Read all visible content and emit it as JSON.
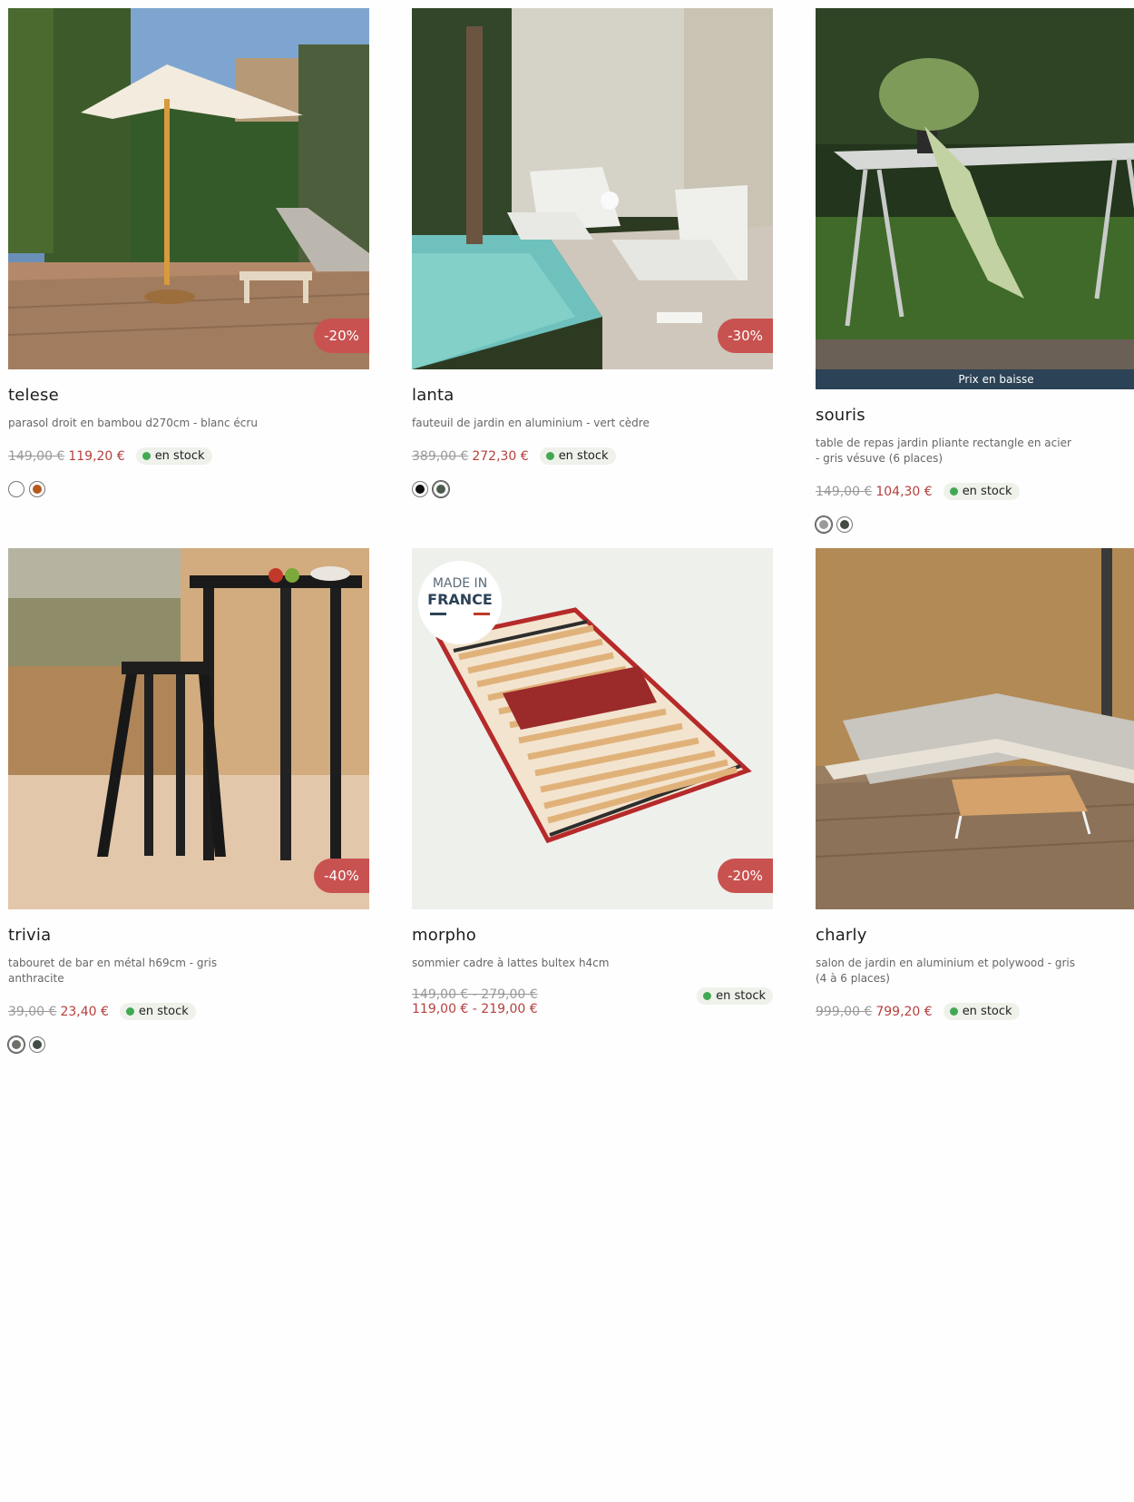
{
  "products": [
    {
      "name": "telese",
      "description": "parasol droit en bambou d270cm - blanc écru",
      "old_price": "149,00 €",
      "new_price": "119,20 €",
      "discount": "-20%",
      "stock": "en stock",
      "swatches": [
        "#ffffff",
        "#b4581c"
      ]
    },
    {
      "name": "lanta",
      "description": "fauteuil de jardin en aluminium - vert cèdre",
      "old_price": "389,00 €",
      "new_price": "272,30 €",
      "discount": "-30%",
      "stock": "en stock",
      "swatches": [
        "#111111",
        "#4c5a4e"
      ]
    },
    {
      "name": "souris",
      "banner": "Prix en baisse",
      "description": "table de repas jardin pliante rectangle en acier - gris vésuve (6 places)",
      "old_price": "149,00 €",
      "new_price": "104,30 €",
      "stock": "en stock",
      "swatches": [
        "#9a9a98",
        "#434c45"
      ]
    },
    {
      "name": "trivia",
      "description": "tabouret de bar en métal h69cm - gris anthracite",
      "old_price": "39,00 €",
      "new_price": "23,40 €",
      "discount": "-40%",
      "stock": "en stock",
      "swatches": [
        "#6e6f6a",
        "#434c45"
      ]
    },
    {
      "name": "morpho",
      "description": "sommier cadre à lattes bultex h4cm",
      "old_price": "149,00 € - 279,00 €",
      "new_price": "119,00 € - 219,00 €",
      "discount": "-20%",
      "stock": "en stock",
      "badge_line1": "MADE IN",
      "badge_line2": "FRANCE"
    },
    {
      "name": "charly",
      "description": "salon de jardin en aluminium et polywood - gris (4 à 6 places)",
      "old_price": "999,00 €",
      "new_price": "799,20 €",
      "stock": "en stock"
    }
  ],
  "colors": {
    "accent_price": "#b6403d",
    "discount_badge": "#c85250",
    "banner": "#2c4256",
    "stock_dot": "#43a853"
  }
}
